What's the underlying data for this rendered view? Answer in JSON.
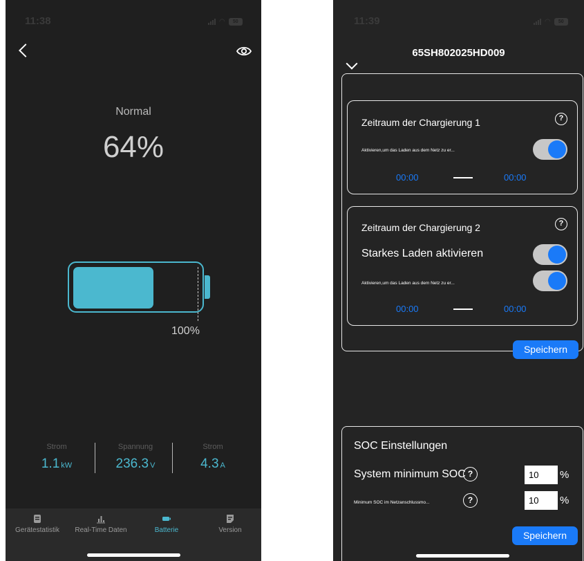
{
  "left_screen": {
    "status_time": "11:38",
    "status_battery": "50",
    "soc_state": "Normal",
    "soc_percent": "64%",
    "soc_level": 0.64,
    "battery_full_label": "100%",
    "stats": [
      {
        "label": "Strom",
        "value": "1.1",
        "unit": "kW"
      },
      {
        "label": "Spannung",
        "value": "236.3",
        "unit": "V"
      },
      {
        "label": "Strom",
        "value": "4.3",
        "unit": "A"
      }
    ],
    "tabs": [
      {
        "label": "Gerätestatistik",
        "icon": "document-icon"
      },
      {
        "label": "Real-Time Daten",
        "icon": "bar-chart-icon"
      },
      {
        "label": "Batterie",
        "icon": "battery-icon",
        "active": true
      },
      {
        "label": "Version",
        "icon": "file-icon"
      }
    ],
    "accent_color": "#4bb8cf"
  },
  "right_screen": {
    "status_time": "11:39",
    "status_battery": "50",
    "device_id": "65SH802025HD009",
    "period1": {
      "title": "Zeitraum der Chargierung 1",
      "enable_text": "Aktivieren,um das Laden aus dem Netz zu er...",
      "start_time": "00:00",
      "end_time": "00:00"
    },
    "period2": {
      "title": "Zeitraum der Chargierung 2",
      "strong_charge_label": "Starkes Laden aktivieren",
      "enable_text": "Aktivieren,um das Laden aus dem Netz zu er...",
      "start_time": "00:00",
      "end_time": "00:00"
    },
    "save_label": "Speichern",
    "soc_settings": {
      "heading": "SOC Einstellungen",
      "system_min_label": "System minimum SOC",
      "system_min_value": "10",
      "grid_min_label": "Minimum SOC im Netzanschlussmo...",
      "grid_min_value": "10",
      "unit": "%",
      "save_label": "Speichern"
    },
    "accent_color": "#1a7af8"
  }
}
